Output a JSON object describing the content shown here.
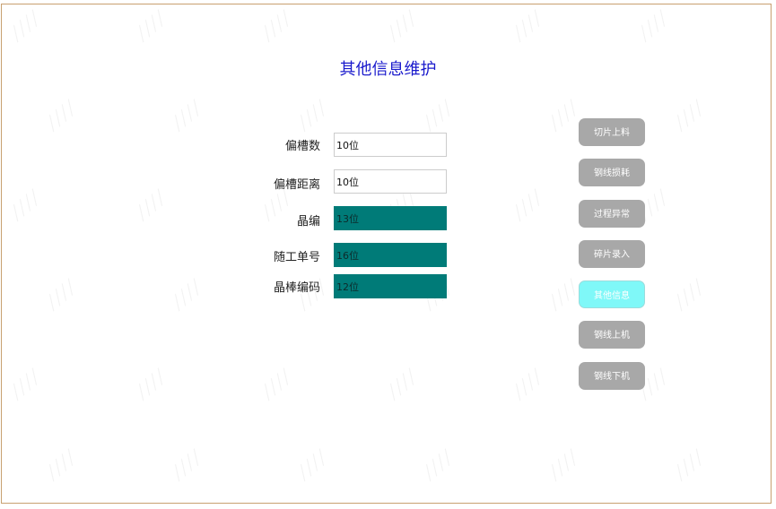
{
  "page": {
    "title": "其他信息维护"
  },
  "form": {
    "fields": [
      {
        "label": "偏槽数",
        "value": "10位",
        "filled": false
      },
      {
        "label": "偏槽距离",
        "value": "10位",
        "filled": false
      },
      {
        "label": "晶编",
        "value": "13位",
        "filled": true
      },
      {
        "label": "随工单号",
        "value": "16位",
        "filled": true
      },
      {
        "label": "晶棒编码",
        "value": "12位",
        "filled": true
      }
    ]
  },
  "sidebar": {
    "buttons": [
      {
        "label": "切片上料",
        "active": false
      },
      {
        "label": "钢线损耗",
        "active": false
      },
      {
        "label": "过程异常",
        "active": false
      },
      {
        "label": "碎片录入",
        "active": false
      },
      {
        "label": "其他信息",
        "active": true
      },
      {
        "label": "钢线上机",
        "active": false
      },
      {
        "label": "钢线下机",
        "active": false
      }
    ]
  },
  "colors": {
    "title": "#1a1acc",
    "filled_input": "#007b78",
    "button": "#a8a8a8",
    "button_active": "#7ff8f8",
    "frame_border": "#c8a070"
  }
}
